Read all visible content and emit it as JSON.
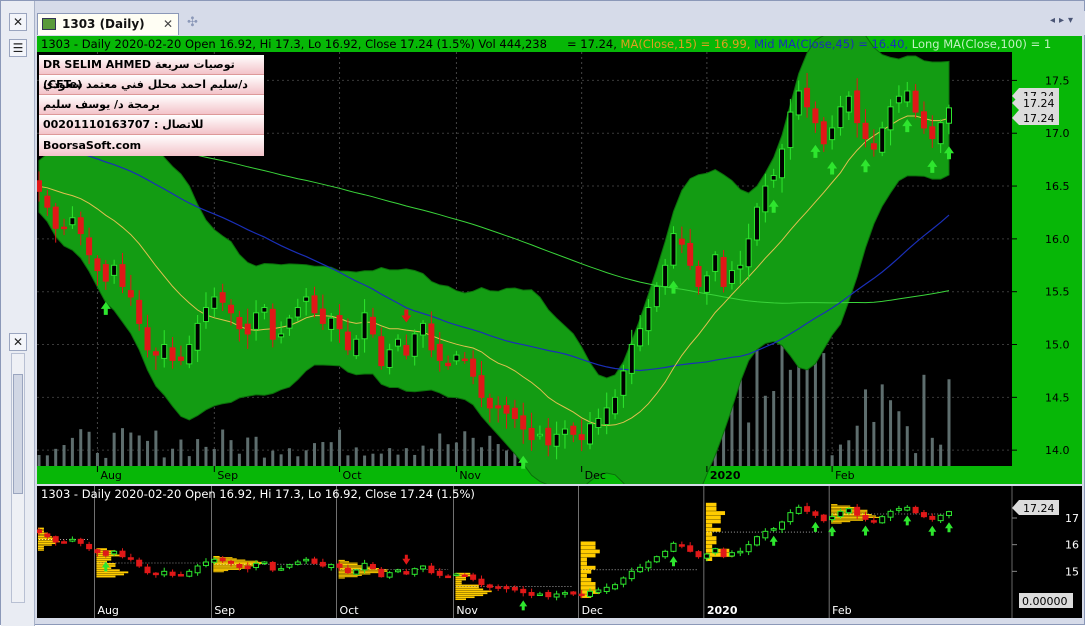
{
  "window": {
    "tab_title": "1303 (Daily)",
    "tab_close": "✕",
    "new_tab": "✣",
    "nav_arrows": "◂▸▾",
    "left_close_top": "✕",
    "left_close_mid": "✕",
    "menu_icon": "☰"
  },
  "colors": {
    "band": "#139c13",
    "up": "#2ee62e",
    "down": "#e01818",
    "axis_panel": "#07b707",
    "ma15": "#e0c050",
    "ma45": "#1a2fb8",
    "ma100": "#3ad43a",
    "volume": "#5e6e6e",
    "profile": "#ffcc00"
  },
  "top_panel": {
    "header_left": "1303 - Daily 2020-02-20 Open 16.92, Hi 17.3, Lo 16.92, Close 17.24 (1.5%) Vol 444,238",
    "header_right_1": " = 17.24, ",
    "header_ma15": "MA(Close,15) = 16.99, ",
    "header_ma45": "Mid MA(Close,45) = 16.40, ",
    "header_ma100": "Long MA(Close,100) = 1",
    "info_box": [
      "DR SELIM AHMED  توصيات سريعة سعودي",
      "(CFTe) د/سليم احمد محلل فني معتمد",
      "برمجة د/ يوسف سليم",
      "00201110163707 : للاتصال",
      "BoorsaSoft.com"
    ],
    "y_ticks": [
      "17.5",
      "17.0",
      "16.5",
      "16.0",
      "15.5",
      "15.0",
      "14.5",
      "14.0"
    ],
    "price_labels": [
      "17.24",
      "17.24",
      "17.24"
    ],
    "x_labels": [
      "Aug",
      "Sep",
      "Oct",
      "Nov",
      "Dec",
      "2020",
      "Feb"
    ]
  },
  "bottom_panel": {
    "header": "1303 - Daily 2020-02-20 Open 16.92, Hi 17.3, Lo 16.92, Close 17.24 (1.5%)",
    "y_ticks": [
      "17",
      "16",
      "15"
    ],
    "price_label": "17.24",
    "zero_label": "0.00000",
    "x_labels": [
      "Aug",
      "Sep",
      "Oct",
      "Nov",
      "Dec",
      "2020",
      "Feb"
    ]
  },
  "chart_data": {
    "type": "candlestick",
    "title": "1303 - Daily",
    "ylim": [
      13.85,
      17.75
    ],
    "x_labels": [
      "Aug",
      "Sep",
      "Oct",
      "Nov",
      "Dec",
      "2020",
      "Feb"
    ],
    "close_path": [
      16.45,
      16.3,
      16.1,
      16.1,
      16.2,
      16.05,
      15.85,
      15.7,
      15.6,
      15.75,
      15.55,
      15.45,
      15.2,
      14.95,
      14.9,
      15.0,
      14.85,
      14.85,
      15.0,
      15.2,
      15.35,
      15.45,
      15.4,
      15.3,
      15.15,
      15.1,
      15.3,
      15.35,
      15.05,
      15.1,
      15.25,
      15.35,
      15.45,
      15.3,
      15.2,
      15.25,
      15.15,
      14.95,
      15.05,
      15.3,
      15.1,
      14.8,
      14.95,
      15.05,
      14.9,
      15.1,
      15.2,
      14.95,
      14.85,
      14.8,
      14.9,
      14.85,
      14.7,
      14.5,
      14.4,
      14.4,
      14.35,
      14.3,
      14.2,
      14.1,
      14.15,
      14.05,
      14.15,
      14.2,
      14.15,
      14.1,
      14.25,
      14.3,
      14.4,
      14.5,
      14.75,
      15.0,
      15.15,
      15.35,
      15.55,
      15.75,
      16.05,
      15.95,
      15.75,
      15.55,
      15.65,
      15.85,
      15.55,
      15.7,
      15.75,
      16.0,
      16.3,
      16.5,
      16.6,
      16.85,
      17.2,
      17.4,
      17.25,
      17.1,
      16.9,
      17.05,
      17.25,
      17.35,
      17.1,
      16.95,
      16.85,
      17.05,
      17.25,
      17.35,
      17.4,
      17.2,
      17.05,
      16.95,
      17.1,
      17.24
    ],
    "up_arrow_indices": [
      8,
      58,
      76,
      88,
      93,
      95,
      99,
      104,
      107,
      109
    ],
    "down_arrow_indices": [
      44
    ]
  }
}
